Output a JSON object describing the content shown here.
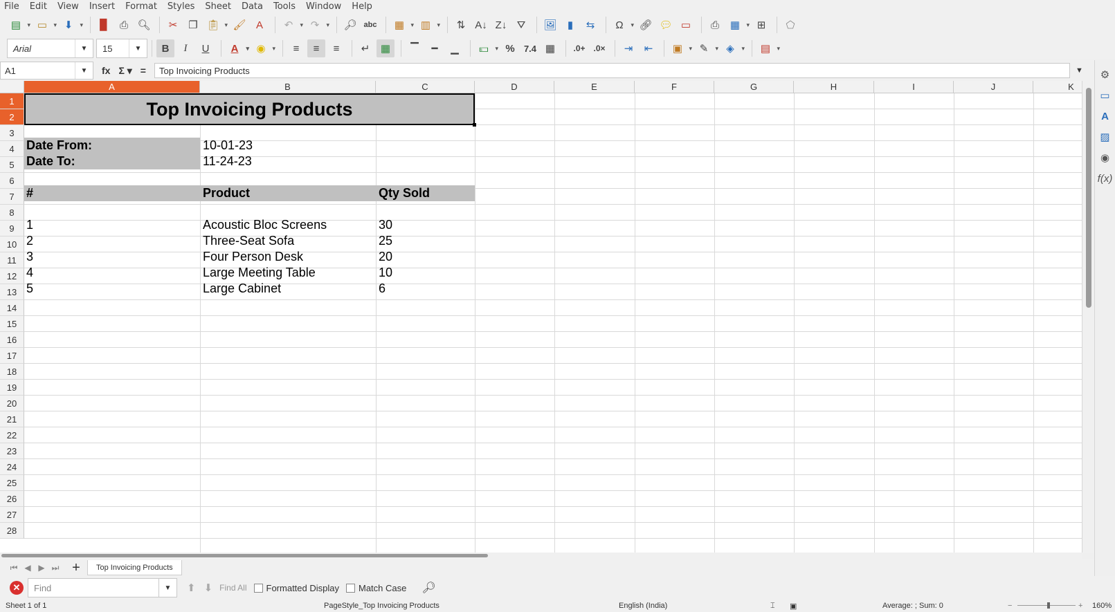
{
  "menu": [
    "File",
    "Edit",
    "View",
    "Insert",
    "Format",
    "Styles",
    "Sheet",
    "Data",
    "Tools",
    "Window",
    "Help"
  ],
  "font": {
    "name": "Arial",
    "size": "15"
  },
  "namebox": "A1",
  "formula": "Top Invoicing Products",
  "columns": [
    "A",
    "B",
    "C",
    "D",
    "E",
    "F",
    "G",
    "H",
    "I",
    "J",
    "K"
  ],
  "rows": [
    "1",
    "2",
    "3",
    "4",
    "5",
    "6",
    "7",
    "8",
    "9",
    "10",
    "11",
    "12",
    "13",
    "14",
    "15",
    "16",
    "17",
    "18",
    "19",
    "20",
    "21",
    "22",
    "23",
    "24",
    "25",
    "26",
    "27",
    "28"
  ],
  "sheet": {
    "title": "Top Invoicing Products",
    "date_from_label": "Date From:",
    "date_from_value": "10-01-23",
    "date_to_label": "Date To:",
    "date_to_value": "11-24-23",
    "headers": {
      "num": "#",
      "product": "Product",
      "qty": "Qty Sold"
    },
    "items": [
      {
        "num": "1",
        "product": "Acoustic Bloc Screens",
        "qty": "30"
      },
      {
        "num": "2",
        "product": "Three-Seat Sofa",
        "qty": "25"
      },
      {
        "num": "3",
        "product": "Four Person Desk",
        "qty": "20"
      },
      {
        "num": "4",
        "product": "Large Meeting Table",
        "qty": "10"
      },
      {
        "num": "5",
        "product": "Large Cabinet",
        "qty": "6"
      }
    ]
  },
  "tab": "Top Invoicing Products",
  "find": {
    "placeholder": "Find",
    "find_all": "Find All",
    "formatted_display": "Formatted Display",
    "match_case": "Match Case"
  },
  "status": {
    "sheet": "Sheet 1 of 1",
    "page_style": "PageStyle_Top Invoicing Products",
    "language": "English (India)",
    "sum": "Average: ; Sum: 0",
    "zoom": "160%"
  },
  "colors": {
    "accent": "#e8612b",
    "header_gray": "#c0c0c0"
  }
}
